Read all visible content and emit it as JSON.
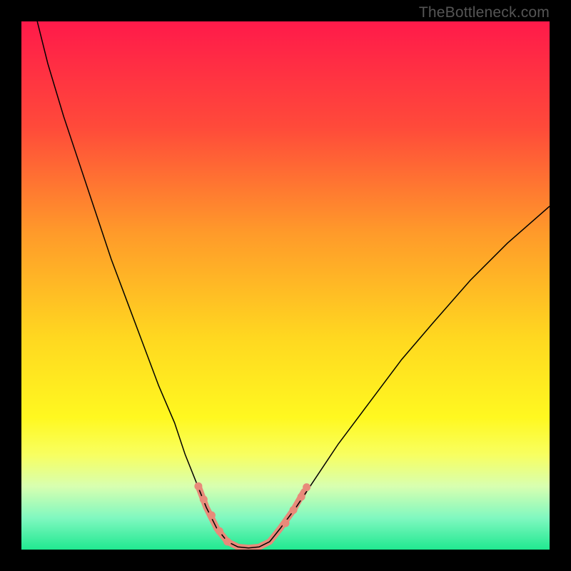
{
  "watermark": "TheBottleneck.com",
  "chart_data": {
    "type": "line",
    "title": "",
    "xlabel": "",
    "ylabel": "",
    "xlim": [
      0,
      100
    ],
    "ylim": [
      0,
      100
    ],
    "gradient_stops": [
      {
        "offset": 0,
        "color": "#ff1a4a"
      },
      {
        "offset": 20,
        "color": "#ff4a3a"
      },
      {
        "offset": 40,
        "color": "#ff9a2a"
      },
      {
        "offset": 60,
        "color": "#ffd820"
      },
      {
        "offset": 75,
        "color": "#fff820"
      },
      {
        "offset": 82,
        "color": "#f8ff60"
      },
      {
        "offset": 88,
        "color": "#d8ffb0"
      },
      {
        "offset": 94,
        "color": "#80f8c0"
      },
      {
        "offset": 100,
        "color": "#20e890"
      }
    ],
    "series": [
      {
        "name": "bottleneck-curve",
        "color": "#000000",
        "width": 1.5,
        "points": [
          {
            "x": 3,
            "y": 100
          },
          {
            "x": 5,
            "y": 92
          },
          {
            "x": 8,
            "y": 82
          },
          {
            "x": 11,
            "y": 73
          },
          {
            "x": 14,
            "y": 64
          },
          {
            "x": 17,
            "y": 55
          },
          {
            "x": 20,
            "y": 47
          },
          {
            "x": 23,
            "y": 39
          },
          {
            "x": 26,
            "y": 31
          },
          {
            "x": 29,
            "y": 24
          },
          {
            "x": 31,
            "y": 18
          },
          {
            "x": 33,
            "y": 13
          },
          {
            "x": 35,
            "y": 8
          },
          {
            "x": 37,
            "y": 4
          },
          {
            "x": 39,
            "y": 1.5
          },
          {
            "x": 41,
            "y": 0.5
          },
          {
            "x": 43,
            "y": 0.3
          },
          {
            "x": 45,
            "y": 0.5
          },
          {
            "x": 47,
            "y": 1.5
          },
          {
            "x": 49,
            "y": 4
          },
          {
            "x": 52,
            "y": 8
          },
          {
            "x": 56,
            "y": 14
          },
          {
            "x": 60,
            "y": 20
          },
          {
            "x": 66,
            "y": 28
          },
          {
            "x": 72,
            "y": 36
          },
          {
            "x": 78,
            "y": 43
          },
          {
            "x": 85,
            "y": 51
          },
          {
            "x": 92,
            "y": 58
          },
          {
            "x": 100,
            "y": 65
          }
        ]
      },
      {
        "name": "highlight-segment",
        "color": "#e88a7a",
        "width": 9,
        "cap": "round",
        "points": [
          {
            "x": 33.5,
            "y": 12
          },
          {
            "x": 35,
            "y": 8
          },
          {
            "x": 37,
            "y": 4
          },
          {
            "x": 39,
            "y": 1.5
          },
          {
            "x": 41,
            "y": 0.5
          },
          {
            "x": 43,
            "y": 0.3
          },
          {
            "x": 45,
            "y": 0.5
          },
          {
            "x": 47,
            "y": 1.5
          },
          {
            "x": 49,
            "y": 4
          },
          {
            "x": 51.5,
            "y": 7.5
          },
          {
            "x": 53.5,
            "y": 11
          }
        ]
      }
    ],
    "highlight_dots": {
      "color": "#e88a7a",
      "radius": 5.5,
      "points": [
        {
          "x": 33.5,
          "y": 12
        },
        {
          "x": 34.5,
          "y": 9.5
        },
        {
          "x": 36,
          "y": 6.5
        },
        {
          "x": 37.5,
          "y": 3.5
        },
        {
          "x": 39,
          "y": 1.5
        },
        {
          "x": 50,
          "y": 5
        },
        {
          "x": 51.5,
          "y": 7.5
        },
        {
          "x": 53,
          "y": 10
        },
        {
          "x": 54,
          "y": 11.8
        }
      ]
    }
  }
}
